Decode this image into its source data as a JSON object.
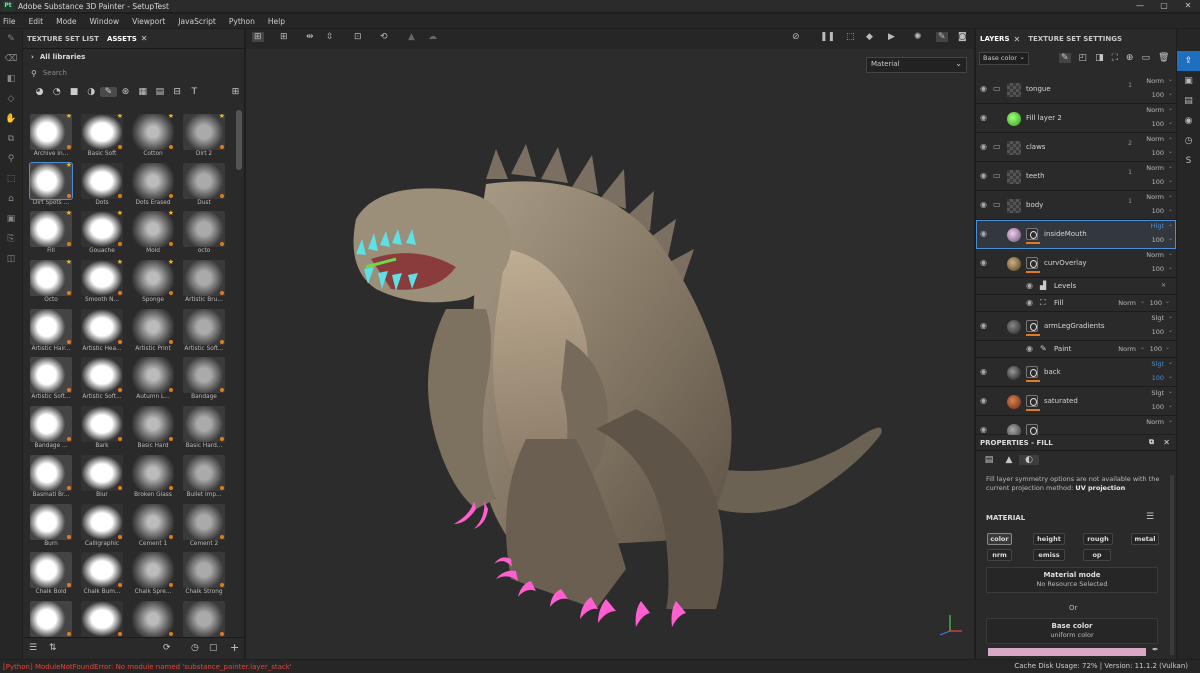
{
  "window": {
    "app_logo": "Pt",
    "title": "Adobe Substance 3D Painter - SetupTest",
    "controls": [
      "—",
      "▢",
      "✕"
    ]
  },
  "menu": [
    "File",
    "Edit",
    "Mode",
    "Window",
    "Viewport",
    "JavaScript",
    "Python",
    "Help"
  ],
  "assets_panel": {
    "tabs": [
      "TEXTURE SET LIST",
      "ASSETS"
    ],
    "library": "All libraries",
    "search_placeholder": "Search",
    "items": [
      {
        "label": "Archive In...",
        "star": true
      },
      {
        "label": "Basic Soft",
        "star": true
      },
      {
        "label": "Cotton",
        "star": true
      },
      {
        "label": "Dirt 2",
        "star": true
      },
      {
        "label": "Dirt Spots ...",
        "star": true,
        "selected": true
      },
      {
        "label": "Dots",
        "star": false
      },
      {
        "label": "Dots Erased",
        "star": false
      },
      {
        "label": "Dust",
        "star": false
      },
      {
        "label": "Fill",
        "star": true
      },
      {
        "label": "Gouache",
        "star": true
      },
      {
        "label": "Mold",
        "star": true
      },
      {
        "label": "octo",
        "star": false
      },
      {
        "label": "Octo",
        "star": true
      },
      {
        "label": "Smooth N...",
        "star": true
      },
      {
        "label": "Sponge",
        "star": true
      },
      {
        "label": "Artistic Bru...",
        "star": false
      },
      {
        "label": "Artistic Hair...",
        "star": false
      },
      {
        "label": "Artistic Hea...",
        "star": false
      },
      {
        "label": "Artistic Print",
        "star": false
      },
      {
        "label": "Artistic Soft...",
        "star": false
      },
      {
        "label": "Artistic Soft...",
        "star": false
      },
      {
        "label": "Artistic Soft...",
        "star": false
      },
      {
        "label": "Autumn L...",
        "star": false
      },
      {
        "label": "Bandage",
        "star": false
      },
      {
        "label": "Bandage ...",
        "star": false
      },
      {
        "label": "Bark",
        "star": false
      },
      {
        "label": "Basic Hard",
        "star": false
      },
      {
        "label": "Basic Hard...",
        "star": false
      },
      {
        "label": "Basmati Br...",
        "star": false
      },
      {
        "label": "Blur",
        "star": false
      },
      {
        "label": "Broken Glass",
        "star": false
      },
      {
        "label": "Bullet Imp...",
        "star": false
      },
      {
        "label": "Burn",
        "star": false
      },
      {
        "label": "Calligraphic",
        "star": false
      },
      {
        "label": "Cement 1",
        "star": false
      },
      {
        "label": "Cement 2",
        "star": false
      },
      {
        "label": "Chalk Bold",
        "star": false
      },
      {
        "label": "Chalk Bum...",
        "star": false
      },
      {
        "label": "Chalk Spre...",
        "star": false
      },
      {
        "label": "Chalk Strong",
        "star": false
      },
      {
        "label": "",
        "star": false
      },
      {
        "label": "",
        "star": false
      },
      {
        "label": "",
        "star": false
      },
      {
        "label": "",
        "star": false
      }
    ]
  },
  "viewport": {
    "material_mode": "Material"
  },
  "layers_panel": {
    "tabs": [
      "LAYERS",
      "TEXTURE SET SETTINGS"
    ],
    "channel": "Base color",
    "rows": [
      {
        "name": "tongue",
        "blend": "Norm",
        "opacity": "100",
        "kind": "folder",
        "count": "1"
      },
      {
        "name": "Fill layer 2",
        "blend": "Norm",
        "opacity": "100",
        "kind": "fill"
      },
      {
        "name": "claws",
        "blend": "Norm",
        "opacity": "100",
        "kind": "folder",
        "count": "2"
      },
      {
        "name": "teeth",
        "blend": "Norm",
        "opacity": "100",
        "kind": "folder",
        "count": "1"
      },
      {
        "name": "body",
        "blend": "Norm",
        "opacity": "100",
        "kind": "folder",
        "count": "1"
      },
      {
        "name": "insideMouth",
        "blend": "Hlgt",
        "opacity": "100",
        "kind": "masked",
        "selected": true
      },
      {
        "name": "curvOverlay",
        "blend": "Norm",
        "opacity": "100",
        "kind": "masked"
      },
      {
        "name": "Levels",
        "kind": "effect"
      },
      {
        "name": "Fill",
        "blend": "Norm",
        "opacity": "100",
        "kind": "effect"
      },
      {
        "name": "armLegGradients",
        "blend": "Slgt",
        "opacity": "100",
        "kind": "masked"
      },
      {
        "name": "Paint",
        "blend": "Norm",
        "opacity": "100",
        "kind": "effect"
      },
      {
        "name": "back",
        "blend": "Slgt",
        "opacity": "100",
        "kind": "masked"
      },
      {
        "name": "saturated",
        "blend": "Slgt",
        "opacity": "100",
        "kind": "masked"
      },
      {
        "name": "",
        "blend": "Norm",
        "opacity": "",
        "kind": "masked"
      }
    ]
  },
  "properties_panel": {
    "title": "PROPERTIES - FILL",
    "notice_line1": "Fill layer symmetry options are not available with the",
    "notice_line2_prefix": "current projection method:",
    "notice_line2_bold": "UV projection",
    "section": "MATERIAL",
    "channels_row1": [
      "color",
      "height",
      "rough",
      "metal"
    ],
    "channels_row2": [
      "nrm",
      "emiss",
      "op"
    ],
    "material_mode_title": "Material mode",
    "material_mode_value": "No Resource Selected",
    "or_label": "Or",
    "base_color_title": "Base color",
    "base_color_value": "uniform color",
    "base_color_swatch": "#d8a8c6"
  },
  "status": {
    "error": "[Python] ModuleNotFoundError: No module named 'substance_painter.layer_stack'",
    "right": "Cache Disk Usage:   72% | Version: 11.1.2 (Vulkan)"
  },
  "colors": {
    "accent": "#1f6fbf",
    "selection": "#4a8fd6",
    "error": "#e0463c",
    "star": "#f3b820",
    "claws": "#ff5fd0",
    "teeth": "#5de0e6"
  }
}
